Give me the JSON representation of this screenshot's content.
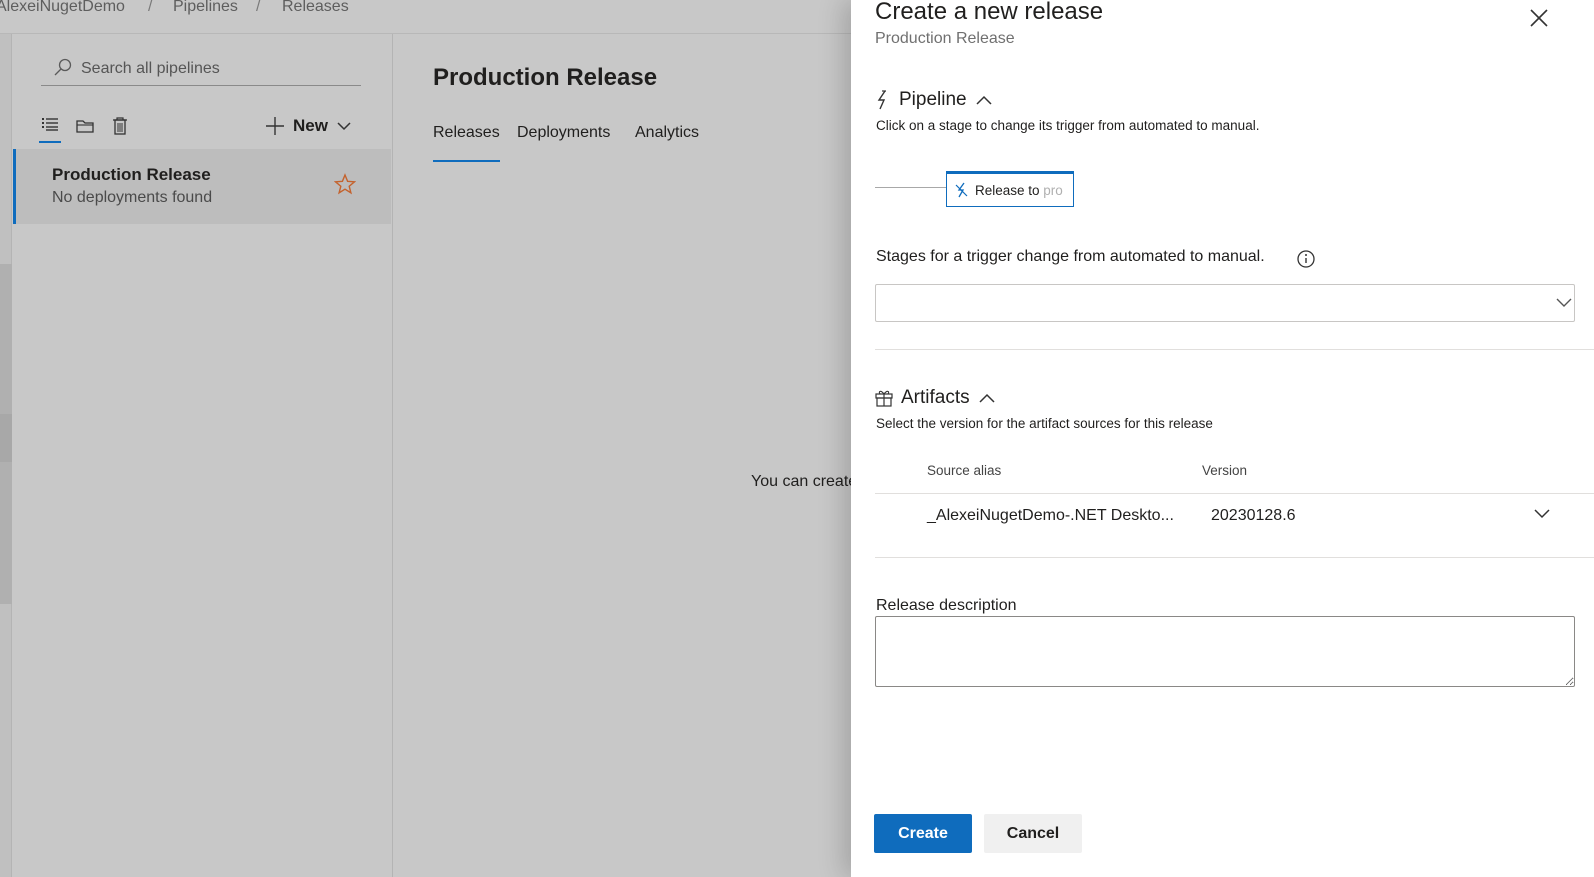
{
  "breadcrumb": {
    "project": "AlexeiNugetDemo",
    "sep": "/",
    "pipelines": "Pipelines",
    "releases": "Releases"
  },
  "sidebar": {
    "search_placeholder": "Search all pipelines",
    "new_label": "New",
    "items": [
      {
        "name": "Production Release",
        "status": "No deployments found"
      }
    ]
  },
  "main": {
    "title": "Production Release",
    "tabs": [
      {
        "label": "Releases"
      },
      {
        "label": "Deployments"
      },
      {
        "label": "Analytics"
      }
    ],
    "empty_text": "You can create"
  },
  "panel": {
    "title": "Create a new release",
    "subtitle": "Production Release",
    "pipeline": {
      "heading": "Pipeline",
      "description": "Click on a stage to change its trigger from automated to manual.",
      "stage_label_visible": "Release to ",
      "stage_label_faded": "pro"
    },
    "stages_label": "Stages for a trigger change from automated to manual.",
    "artifacts": {
      "heading": "Artifacts",
      "description": "Select the version for the artifact sources for this release",
      "columns": [
        "Source alias",
        "Version"
      ],
      "rows": [
        {
          "alias": "_AlexeiNugetDemo-.NET Deskto...",
          "version": "20230128.6"
        }
      ]
    },
    "release_description_label": "Release description",
    "create_label": "Create",
    "cancel_label": "Cancel"
  },
  "colors": {
    "accent": "#0f6cbd",
    "star": "#c4622d"
  }
}
